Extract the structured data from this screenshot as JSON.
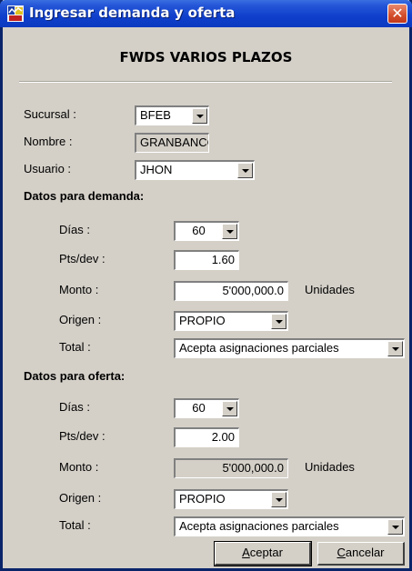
{
  "window": {
    "title": "Ingresar demanda y oferta",
    "close_glyph": "✕",
    "app_icon": "app-icon"
  },
  "header": {
    "title": "FWDS VARIOS PLAZOS"
  },
  "general": {
    "sucursal_label": "Sucursal :",
    "sucursal_value": "BFEB",
    "nombre_label": "Nombre :",
    "nombre_value": "GRANBANCO",
    "usuario_label": "Usuario :",
    "usuario_value": "JHON"
  },
  "demanda": {
    "section_label": "Datos para demanda:",
    "dias_label": "Días :",
    "dias_value": "60",
    "pts_label": "Pts/dev :",
    "pts_value": "1.60",
    "monto_label": "Monto :",
    "monto_value": "5'000,000.0",
    "monto_units": "Unidades",
    "origen_label": "Origen :",
    "origen_value": "PROPIO",
    "total_label": "Total :",
    "total_value": "Acepta asignaciones parciales"
  },
  "oferta": {
    "section_label": "Datos para oferta:",
    "dias_label": "Días :",
    "dias_value": "60",
    "pts_label": "Pts/dev :",
    "pts_value": "2.00",
    "monto_label": "Monto :",
    "monto_value": "5'000,000.0",
    "monto_units": "Unidades",
    "origen_label": "Origen :",
    "origen_value": "PROPIO",
    "total_label": "Total :",
    "total_value": "Acepta asignaciones parciales"
  },
  "buttons": {
    "aceptar_mnemonic": "A",
    "aceptar_rest": "ceptar",
    "cancelar_mnemonic": "C",
    "cancelar_rest": "ancelar"
  },
  "colors": {
    "titlebar": "#0b3ac0",
    "window_bg": "#d4d0c8",
    "close_button": "#d34d2a"
  }
}
